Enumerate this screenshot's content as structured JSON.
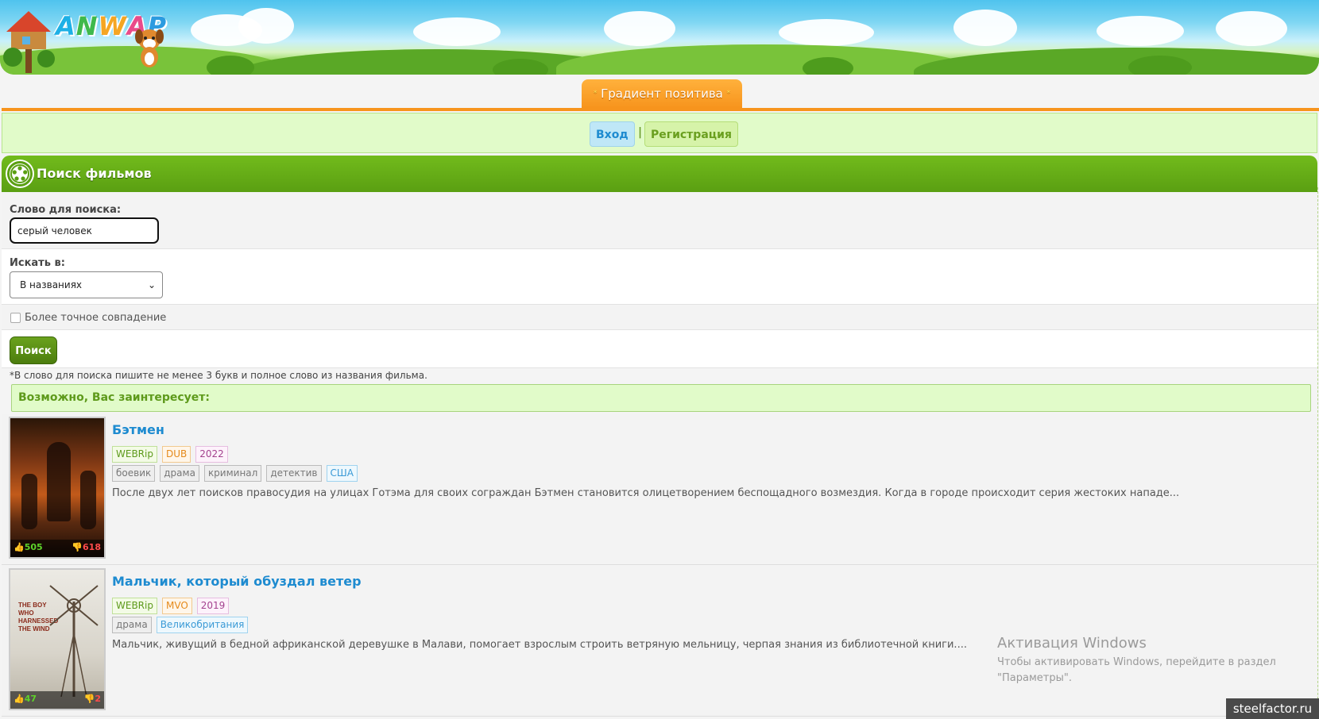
{
  "header": {
    "logo_letters": [
      "A",
      "N",
      "W",
      "A",
      "P"
    ],
    "logo_colors": [
      "#1db0e6",
      "#3fb94c",
      "#f5a623",
      "#e94b8a",
      "#2b9be0"
    ]
  },
  "tab": {
    "label": "Градиент позитива",
    "star": "*"
  },
  "auth": {
    "login": "Вход",
    "separator": "|",
    "register": "Регистрация"
  },
  "section": {
    "title": "Поиск фильмов",
    "icon": "film-reel-icon"
  },
  "form": {
    "query_label": "Слово для поиска:",
    "query_value": "серый человек",
    "scope_label": "Искать в:",
    "scope_selected": "В названиях",
    "exact_label": "Более точное совпадение",
    "exact_checked": false,
    "submit_label": "Поиск",
    "note": "*В слово для поиска пишите не менее 3 букв и полное слово из названия фильма."
  },
  "suggest": {
    "title": "Возможно, Вас заинтересует:"
  },
  "movies": [
    {
      "title": "Бэтмен",
      "quality": "WEBRip",
      "translation": "DUB",
      "year": "2022",
      "genres": [
        "боевик",
        "драма",
        "криминал",
        "детектив"
      ],
      "country": "США",
      "likes": "505",
      "dislikes": "618",
      "description": "После двух лет поисков правосудия на улицах Готэма для своих сограждан Бэтмен становится олицетворением беспощадного возмездия. Когда в городе происходит серия жестоких нападе..."
    },
    {
      "title": "Мальчик, который обуздал ветер",
      "quality": "WEBRip",
      "translation": "MVO",
      "year": "2019",
      "genres": [
        "драма"
      ],
      "country": "Великобритания",
      "likes": "47",
      "dislikes": "2",
      "poster_text": "THE BOY WHO HARNESSED THE WIND",
      "description": "Мальчик, живущий в бедной африканской деревушке в Малави, помогает взрослым строить ветряную мельницу, черпая знания из библиотечной книги...."
    }
  ],
  "watermark": {
    "title": "Активация Windows",
    "line1": "Чтобы активировать Windows, перейдите в раздел",
    "line2": "\"Параметры\"."
  },
  "site_badge": "steelfactor.ru"
}
